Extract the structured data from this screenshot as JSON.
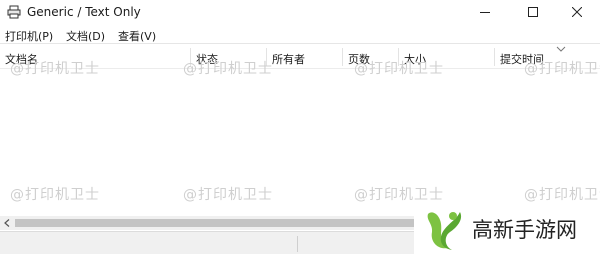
{
  "window": {
    "title": "Generic / Text Only"
  },
  "menu": [
    {
      "label": "打印机(P)"
    },
    {
      "label": "文档(D)"
    },
    {
      "label": "查看(V)"
    }
  ],
  "columns": [
    {
      "label": "文档名"
    },
    {
      "label": "状态"
    },
    {
      "label": "所有者"
    },
    {
      "label": "页数"
    },
    {
      "label": "大小"
    },
    {
      "label": "提交时间"
    }
  ],
  "watermark": "@打印机卫士",
  "brand": {
    "name": "高新手游网",
    "colors": {
      "green": "#7dc242",
      "dark": "#222222"
    }
  }
}
